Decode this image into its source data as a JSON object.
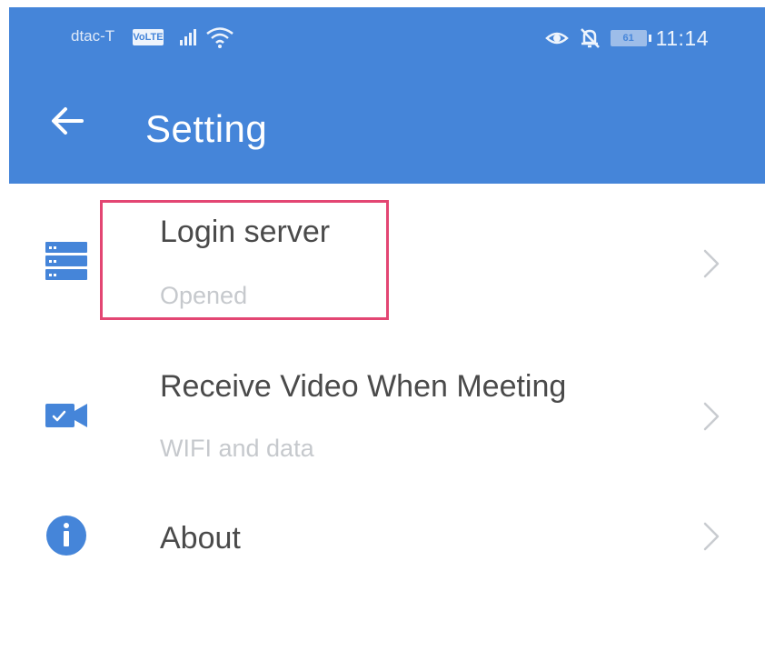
{
  "status_bar": {
    "carrier": "dtac-T",
    "volte_badge": "VoLTE",
    "battery_level": "61",
    "time": "11:14",
    "icons": [
      "signal-icon",
      "wifi-icon",
      "eye-icon",
      "bell-off-icon",
      "battery-icon"
    ]
  },
  "app_bar": {
    "title": "Setting",
    "back_icon": "arrow-left-icon",
    "background_color": "#4585d9"
  },
  "settings": {
    "items": [
      {
        "label": "Login server",
        "subtitle": "Opened",
        "icon": "server-icon",
        "highlighted": true
      },
      {
        "label": "Receive Video When Meeting",
        "subtitle": "WIFI and data",
        "icon": "video-camera-icon"
      },
      {
        "label": "About",
        "subtitle": "",
        "icon": "info-icon"
      }
    ]
  },
  "colors": {
    "accent": "#4585d9",
    "highlight": "#e34673",
    "label_text": "#4a4a4a",
    "subtitle_text": "#c6c9cd"
  }
}
